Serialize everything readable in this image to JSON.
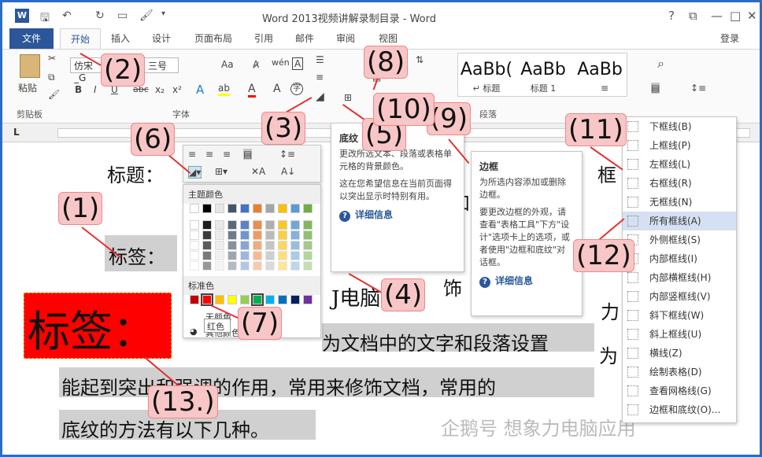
{
  "app": {
    "title": "Word 2013视频讲解录制目录 - Word",
    "logo": "W"
  },
  "quick_access": [
    "save-icon",
    "undo-icon",
    "redo-icon",
    "new-doc-icon",
    "format-painter-icon",
    "customize-icon"
  ],
  "window": {
    "help": "?",
    "restore": "⧉",
    "min": "—",
    "max": "□",
    "close": "✕"
  },
  "tabs": {
    "file": "文件",
    "home": "开始",
    "insert": "插入",
    "design": "设计",
    "layout": "页面布局",
    "refs": "引用",
    "mail": "邮件",
    "review": "审阅",
    "view": "视图",
    "login": "登录"
  },
  "ribbon": {
    "clipboard": {
      "paste": "粘贴",
      "label": "剪贴板"
    },
    "font": {
      "name": "仿宋_G",
      "size": "三号",
      "label": "字体",
      "bold": "B",
      "italic": "I",
      "underline": "U",
      "strike": "abc",
      "sub": "x₂",
      "sup": "x²",
      "grow": "A",
      "aa": "Aa",
      "wen": "wén",
      "A": "A"
    },
    "paragraph": {
      "label": "段落"
    },
    "styles": [
      {
        "preview": "AaBb(",
        "name": "↵ 标题"
      },
      {
        "preview": "AaBb",
        "name": "标题 1"
      },
      {
        "preview": "AaBb",
        "name": ""
      }
    ],
    "find": "⌕"
  },
  "ruler": {
    "corner": "L"
  },
  "mini_toolbar": {
    "shading_label": "底纹"
  },
  "palette": {
    "theme_label": "主题颜色",
    "standard_label": "标准色",
    "no_color": "无颜色",
    "more_colors": "其他颜色(M)...",
    "tooltip": "红色",
    "theme_row": [
      "#ffffff",
      "#000000",
      "#e7e6e6",
      "#44546a",
      "#4472c4",
      "#ed7d31",
      "#a5a5a5",
      "#ffc000",
      "#5b9bd5",
      "#70ad47"
    ],
    "standard_row": [
      "#c00000",
      "#ff0000",
      "#ffc000",
      "#ffff00",
      "#92d050",
      "#00b050",
      "#00b0f0",
      "#0070c0",
      "#002060",
      "#7030a0"
    ]
  },
  "shading_tip": {
    "title": "底纹",
    "text": "更改所选文本、段落或表格单元格的背景颜色。",
    "text2": "这在您希望信息在当前页面得以突出显示时特别有用。",
    "link": "详细信息"
  },
  "border_tip": {
    "title": "边框",
    "text": "为所选内容添加或删除边框。",
    "text2": "要更改边框的外观，请查看\"表格工具\"下方\"设计\"选项卡上的选项，或者使用\"边框和底纹\"对话框。",
    "link": "详细信息"
  },
  "border_menu": [
    "下框线(B)",
    "上框线(P)",
    "左框线(L)",
    "右框线(R)",
    "无框线(N)",
    "所有框线(A)",
    "外侧框线(S)",
    "内部框线(I)",
    "内部横框线(H)",
    "内部竖框线(V)",
    "斜下框线(W)",
    "斜上框线(U)",
    "横线(Z)",
    "绘制表格(D)",
    "查看网格线(G)",
    "边框和底纹(O)..."
  ],
  "document": {
    "line1": "标题：",
    "line1_right": "框",
    "line2": "标签：",
    "big_label": "标签：",
    "line3a": "为文档中的文字和段落设置",
    "line3b": "为",
    "line4": "能起到突出和强调的作用，常用来修饰文档，常用的",
    "line5": "底纹的方法有以下几种。",
    "frag_he": "和",
    "frag_shi": "饰",
    "frag_dian": "J电脑",
    "frag_li": "力"
  },
  "callouts": [
    "(1)",
    "(2)",
    "(3)",
    "(4)",
    "(5)",
    "(6)",
    "(7)",
    "(8)",
    "(9)",
    "(10)",
    "(11)",
    "(12)",
    "(13.)"
  ],
  "watermark": "企鹅号 想象力电脑应用",
  "colors": {
    "accent": "#2b579a",
    "callout_bg": "#f8c6c6",
    "arrow": "#e53030",
    "red_label": "#ff0000"
  }
}
